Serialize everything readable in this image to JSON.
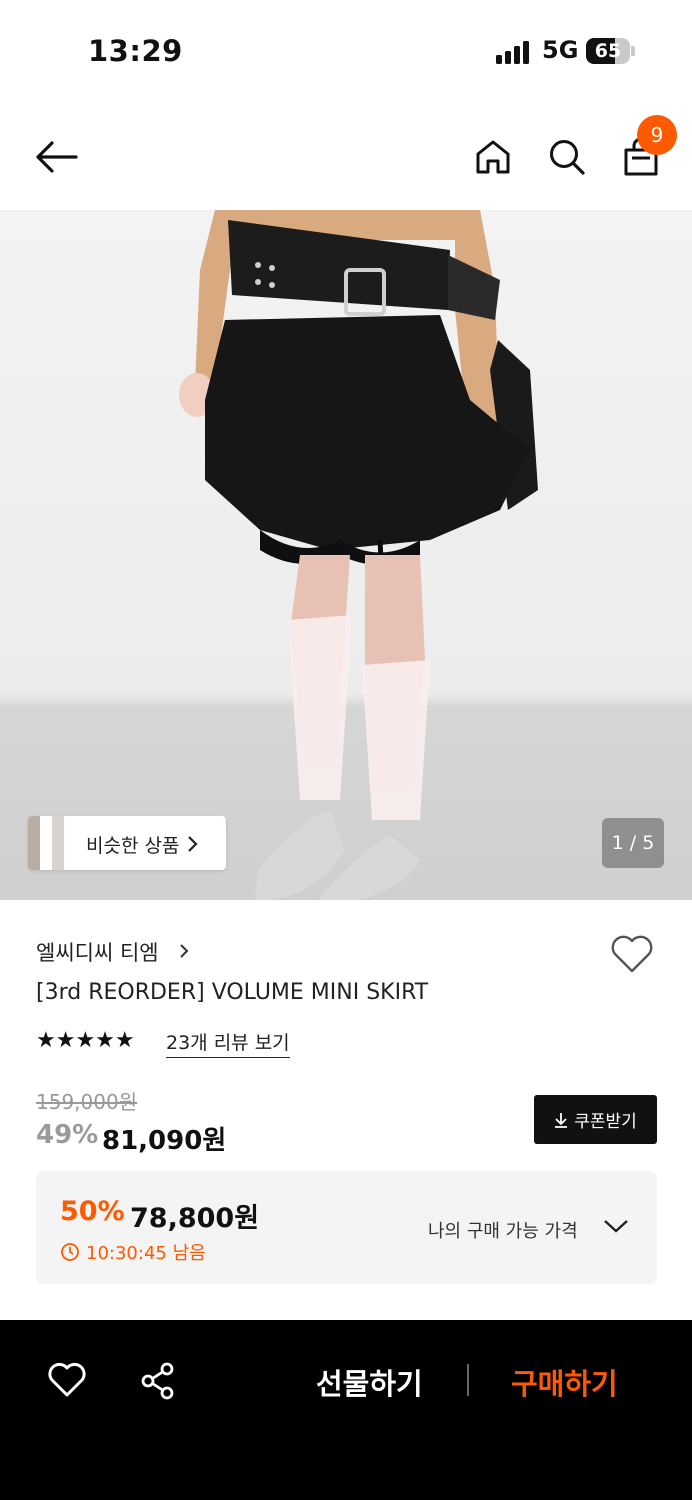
{
  "status_bar": {
    "time": "13:29",
    "network": "5G",
    "battery": "65",
    "battery_level_percent": 65
  },
  "nav": {
    "back_icon": "arrow-left-icon",
    "home_icon": "home-icon",
    "search_icon": "search-icon",
    "cart_icon": "shopping-bag-icon",
    "cart_count": "9"
  },
  "gallery": {
    "similar_label": "비슷한 상품",
    "page_indicator": "1 / 5"
  },
  "product": {
    "brand": "엘씨디씨 티엠",
    "title": "[3rd REORDER] VOLUME MINI SKIRT",
    "stars": "★★★★★",
    "rating_stars_filled": 5,
    "reviews_link": "23개 리뷰 보기",
    "original_price": "159,000원",
    "discount": "49%",
    "price": "81,090원",
    "coupon_label": "쿠폰받기"
  },
  "my_price": {
    "discount": "50%",
    "price": "78,800원",
    "timer": "10:30:45 남음",
    "label": "나의 구매 가능 가격"
  },
  "bottom_bar": {
    "gift_label": "선물하기",
    "buy_label": "구매하기"
  },
  "colors": {
    "accent": "#ff5a00",
    "dark": "#111111",
    "muted": "#9a9a9a"
  }
}
